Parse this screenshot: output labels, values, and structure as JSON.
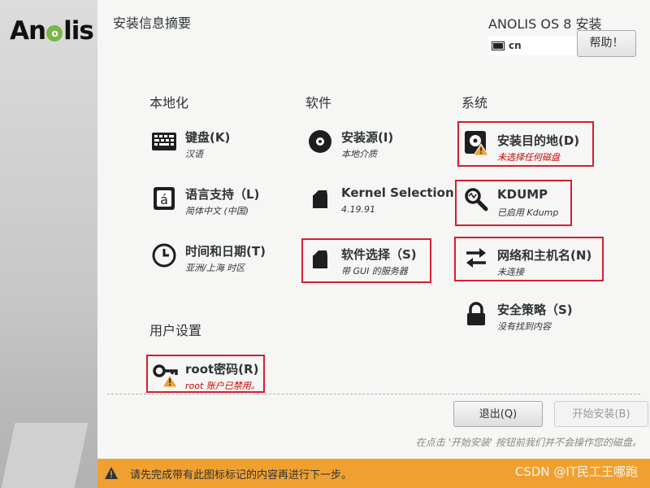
{
  "sidebar": {
    "logo_text_left": "An",
    "logo_text_right": "lis",
    "logo_leaf": "o"
  },
  "header": {
    "title": "安装信息摘要",
    "product": "ANOLIS OS 8 安装",
    "keyboard_layout": "cn",
    "help_label": "帮助！"
  },
  "sections": {
    "localization": "本地化",
    "software": "软件",
    "system": "系统",
    "user": "用户设置"
  },
  "spokes": {
    "keyboard": {
      "label": "键盘(K)",
      "status": "汉语",
      "icon": "keyboard-icon"
    },
    "language": {
      "label": "语言支持（L)",
      "status": "简体中文 (中国)",
      "icon": "language-icon"
    },
    "datetime": {
      "label": "时间和日期(T)",
      "status": "亚洲/上海 时区",
      "icon": "clock-icon"
    },
    "source": {
      "label": "安装源(I)",
      "status": "本地介质",
      "icon": "disc-icon"
    },
    "kernel": {
      "label": "Kernel Selection",
      "status": "4.19.91",
      "icon": "package-icon"
    },
    "software": {
      "label": "软件选择（S)",
      "status": "带 GUI 的服务器",
      "icon": "package-icon"
    },
    "destination": {
      "label": "安装目的地(D)",
      "status": "未选择任何磁盘",
      "icon": "disk-warning-icon"
    },
    "kdump": {
      "label": "KDUMP",
      "status": "已启用 Kdump",
      "icon": "magnifier-icon"
    },
    "network": {
      "label": "网络和主机名(N)",
      "status": "未连接",
      "icon": "network-arrows-icon"
    },
    "security": {
      "label": "安全策略（S)",
      "status": "没有找到内容",
      "icon": "lock-icon"
    },
    "root": {
      "label": "root密码(R)",
      "status": "root 账户已禁用。",
      "icon": "key-warning-icon"
    }
  },
  "footer": {
    "quit_label": "退出(Q)",
    "begin_label": "开始安装(B)",
    "note": "在点击 '开始安装' 按钮前我们并不会操作您的磁盘。"
  },
  "warning_bar": {
    "text": "请先完成带有此图标标记的内容再进行下一步。",
    "watermark": "CSDN @IT民工王哪跑"
  },
  "colors": {
    "highlight_box": "#d41f2e",
    "warning_bar": "#f0a030",
    "warning_text": "#cc0000"
  }
}
